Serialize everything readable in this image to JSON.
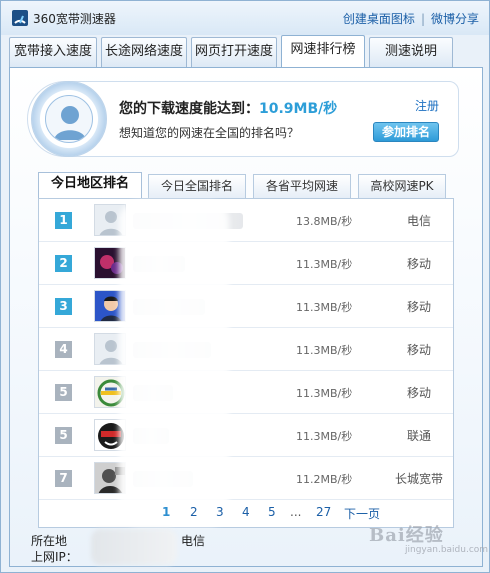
{
  "window": {
    "title": "360宽带测速器",
    "links": [
      "创建桌面图标",
      "微博分享"
    ]
  },
  "main_tabs": [
    "宽带接入速度",
    "长途网络速度",
    "网页打开速度",
    "网速排行榜",
    "测速说明"
  ],
  "speed_card": {
    "prefix": "您的下载速度能达到：",
    "value": "10.9MB/秒",
    "question": "想知道您的网速在全国的排名吗？",
    "register": "注册",
    "join_button": "参加排名"
  },
  "sub_tabs": [
    "今日地区排名",
    "今日全国排名",
    "各省平均网速",
    "高校网速PK"
  ],
  "ranking": {
    "badge_colors": [
      "#35a8d8",
      "#35a8d8",
      "#35a8d8",
      "#a9b3be",
      "#a9b3be",
      "#a9b3be",
      "#a9b3be"
    ],
    "rows": [
      {
        "rank": "1",
        "speed": "13.8MB/秒",
        "isp": "电信",
        "avatar": "default-avatar-icon"
      },
      {
        "rank": "2",
        "speed": "11.3MB/秒",
        "isp": "移动",
        "avatar": "photo-avatar-icon"
      },
      {
        "rank": "3",
        "speed": "11.3MB/秒",
        "isp": "移动",
        "avatar": "person-avatar-icon"
      },
      {
        "rank": "4",
        "speed": "11.3MB/秒",
        "isp": "移动",
        "avatar": "default-avatar-icon"
      },
      {
        "rank": "5",
        "speed": "11.3MB/秒",
        "isp": "移动",
        "avatar": "logo-avatar-icon"
      },
      {
        "rank": "5",
        "speed": "11.3MB/秒",
        "isp": "联通",
        "avatar": "mask-avatar-icon"
      },
      {
        "rank": "7",
        "speed": "11.2MB/秒",
        "isp": "长城宽带",
        "avatar": "bw-photo-avatar-icon"
      }
    ]
  },
  "pager": {
    "pages": [
      "1",
      "2",
      "3",
      "4",
      "5",
      "...",
      "27"
    ],
    "next": "下一页"
  },
  "footer": {
    "location_label": "所在地",
    "ip_label": "上网IP：",
    "isp": "电信"
  },
  "watermark": {
    "text": "Bai经验",
    "sub": "jingyan.baidu.com"
  }
}
